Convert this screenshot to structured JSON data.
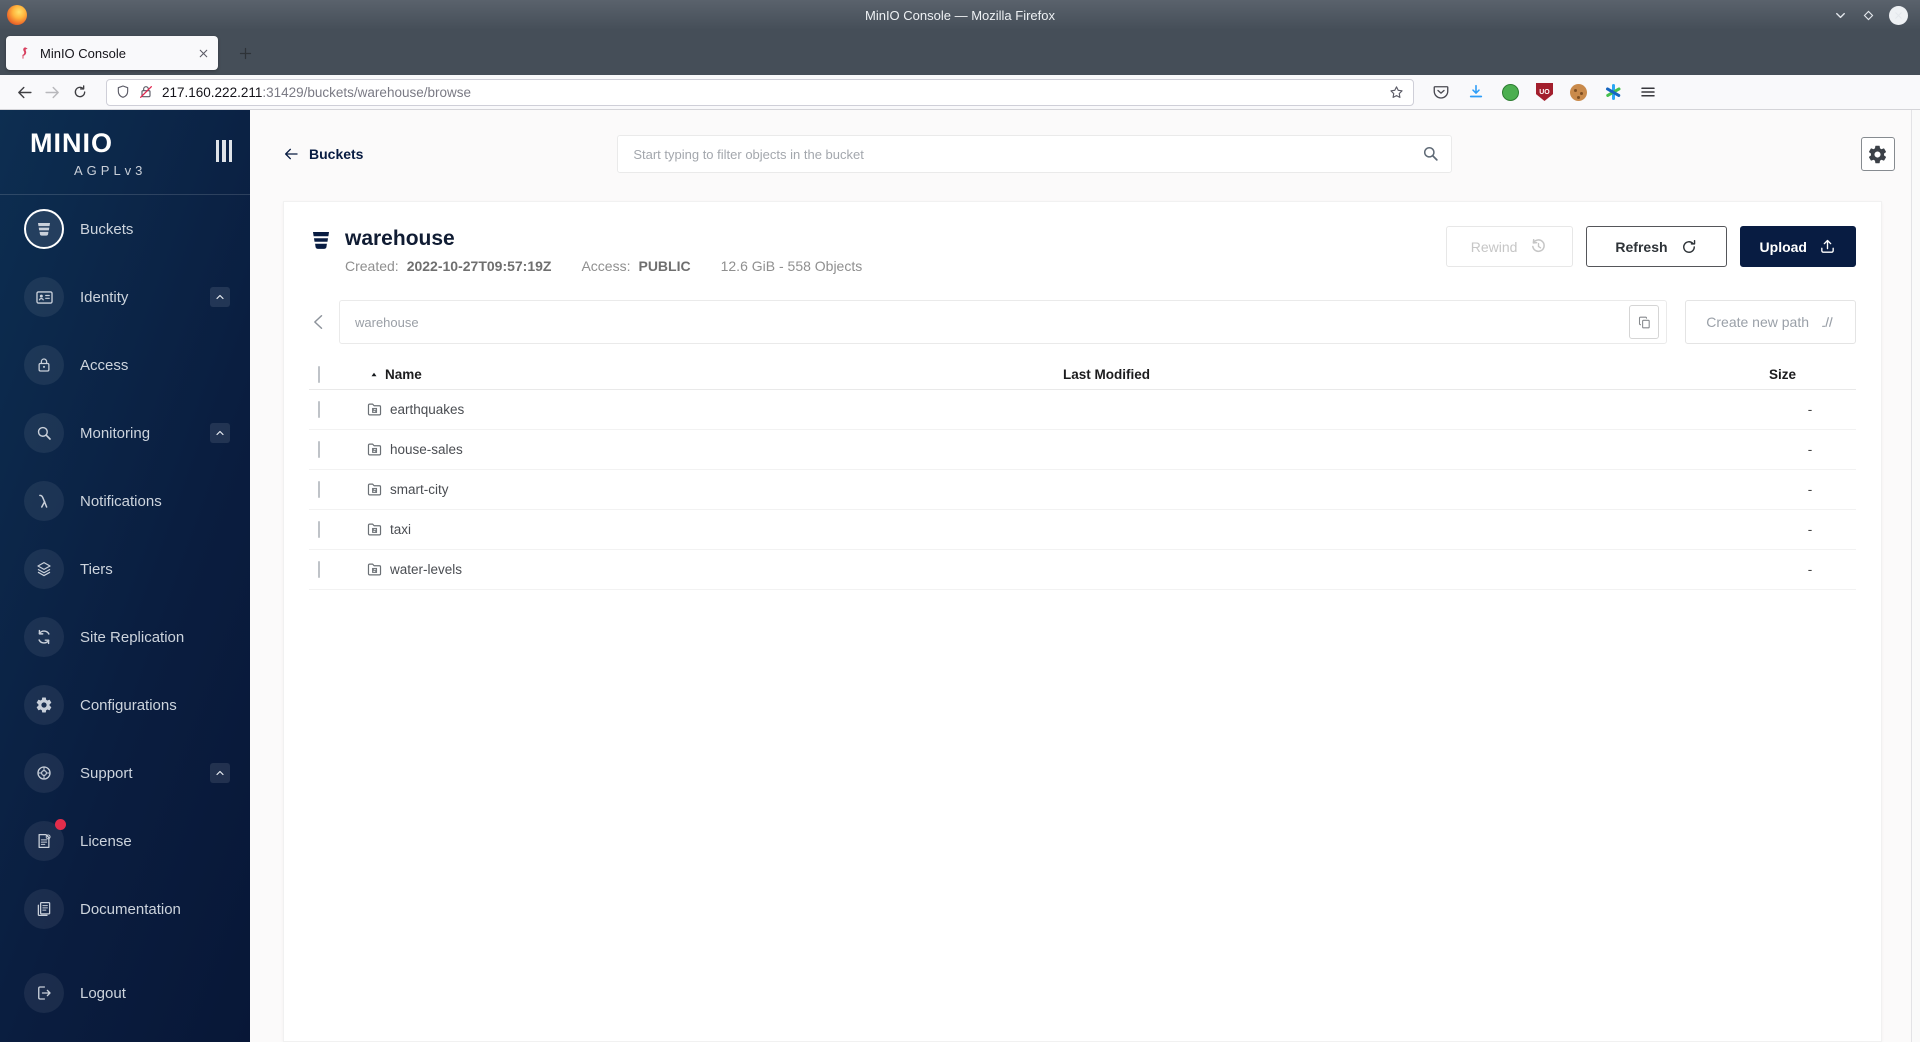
{
  "browser": {
    "window_title": "MinIO Console — Mozilla Firefox",
    "tab_title": "MinIO Console",
    "url_host": "217.160.222.211",
    "url_path": ":31429/buckets/warehouse/browse",
    "ublock_label": "UO"
  },
  "sidebar": {
    "logo": "MINIO",
    "edition": "AGPLv3",
    "items": [
      {
        "label": "Buckets"
      },
      {
        "label": "Identity"
      },
      {
        "label": "Access"
      },
      {
        "label": "Monitoring"
      },
      {
        "label": "Notifications"
      },
      {
        "label": "Tiers"
      },
      {
        "label": "Site Replication"
      },
      {
        "label": "Configurations"
      },
      {
        "label": "Support"
      },
      {
        "label": "License"
      },
      {
        "label": "Documentation"
      },
      {
        "label": "Logout"
      }
    ]
  },
  "header": {
    "breadcrumb": "Buckets",
    "search_placeholder": "Start typing to filter objects in the bucket"
  },
  "bucket": {
    "name": "warehouse",
    "created_label": "Created:",
    "created": "2022-10-27T09:57:19Z",
    "access_label": "Access:",
    "access": "PUBLIC",
    "usage": "12.6 GiB - 558 Objects",
    "buttons": {
      "rewind": "Rewind",
      "refresh": "Refresh",
      "upload": "Upload"
    }
  },
  "pathbar": {
    "path": "warehouse",
    "create_button": "Create new path"
  },
  "table": {
    "columns": [
      "Name",
      "Last Modified",
      "Size"
    ],
    "rows": [
      {
        "name": "earthquakes",
        "size": "-"
      },
      {
        "name": "house-sales",
        "size": "-"
      },
      {
        "name": "smart-city",
        "size": "-"
      },
      {
        "name": "taxi",
        "size": "-"
      },
      {
        "name": "water-levels",
        "size": "-"
      }
    ]
  },
  "colors": {
    "brand_navy": "#081C42",
    "sidebar_gradient_start": "#0d2e51",
    "sidebar_gradient_end": "#081737",
    "badge_red": "#e22d4b",
    "content_bg": "#fbfafa"
  }
}
